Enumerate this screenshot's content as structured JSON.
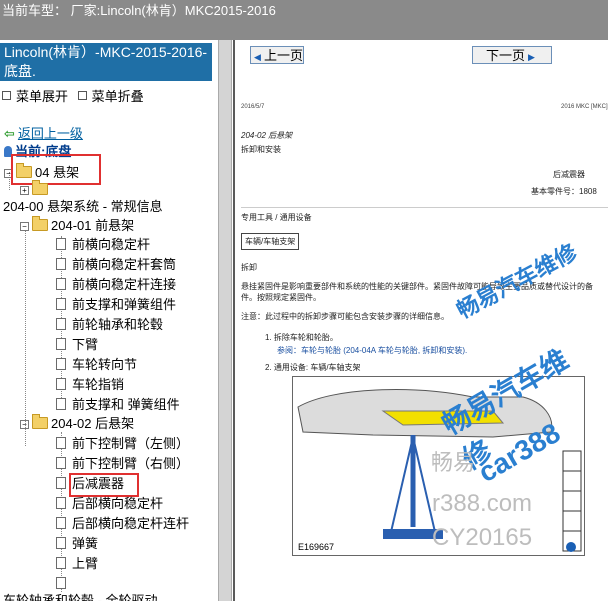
{
  "header": {
    "current_car": "当前车型： 厂家:Lincoln(林肯）MKC2015-2016"
  },
  "sidebar": {
    "car_title": "Lincoln(林肯）-MKC-2015-2016- 底盘.",
    "expand_label": "菜单展开",
    "collapse_label": "菜单折叠",
    "back_label": "返回上一级",
    "current_label": "当前:底盘",
    "root_folder": "04 悬架",
    "group_title": "204-00 悬架系统 - 常规信息",
    "front_folder": "204-01 前悬架",
    "front_items": [
      "前横向稳定杆",
      "前横向稳定杆套筒",
      "前横向稳定杆连接",
      "前支撑和弹簧组件",
      "前轮轴承和轮毂",
      "下臂",
      "车轮转向节",
      "车轮指销",
      "前支撑和 弹簧组件"
    ],
    "rear_folder": "204-02 后悬架",
    "rear_items": [
      "前下控制臂（左侧）",
      "前下控制臂（右侧）",
      "后减震器",
      "后部横向稳定杆",
      "后部横向稳定杆连杆",
      "弹簧",
      "上臂"
    ],
    "bottom_cut": "车轮轴承和轮毂 - 全轮驱动"
  },
  "nav": {
    "prev_label": "上一页",
    "next_label": "下一页"
  },
  "doc": {
    "date": "2016/5/7",
    "model": "2016 MKC [MKC]",
    "section": "204-02 后悬架",
    "subsection": "拆卸和安装",
    "component": "后减震器",
    "part_no": "基本零件号：1808",
    "tools_label": "专用工具 / 通用设备",
    "tool_box": "车辆/车轴支架",
    "remove_title": "拆卸",
    "warning": "悬挂紧固件是影响重要部件和系统的性能的关键部件。紧固件故障可能导致主要品质或替代设计的备件。按照规定紧固件。",
    "note": "注意：此过程中的拆卸步骤可能包含安装步骤的详细信息。",
    "step1": "1.  拆除车轮和轮胎。",
    "step1_ref": "参阅：车轮与轮胎 (204-04A 车轮与轮胎, 拆卸和安装).",
    "step2": "2.  通用设备: 车辆/车轴支架",
    "figure_id": "E169667"
  },
  "watermarks": {
    "a": "畅易汽车维修",
    "b": "畅易汽车维修",
    "c": "car388",
    "d": "畅易",
    "e": "r388.com",
    "f": "CY20165"
  },
  "colors": {
    "title_bg": "#1f6fa6",
    "topbar_bg": "#8a8a8a",
    "highlight": "#e03030",
    "watermark": "#2a7fd0"
  }
}
